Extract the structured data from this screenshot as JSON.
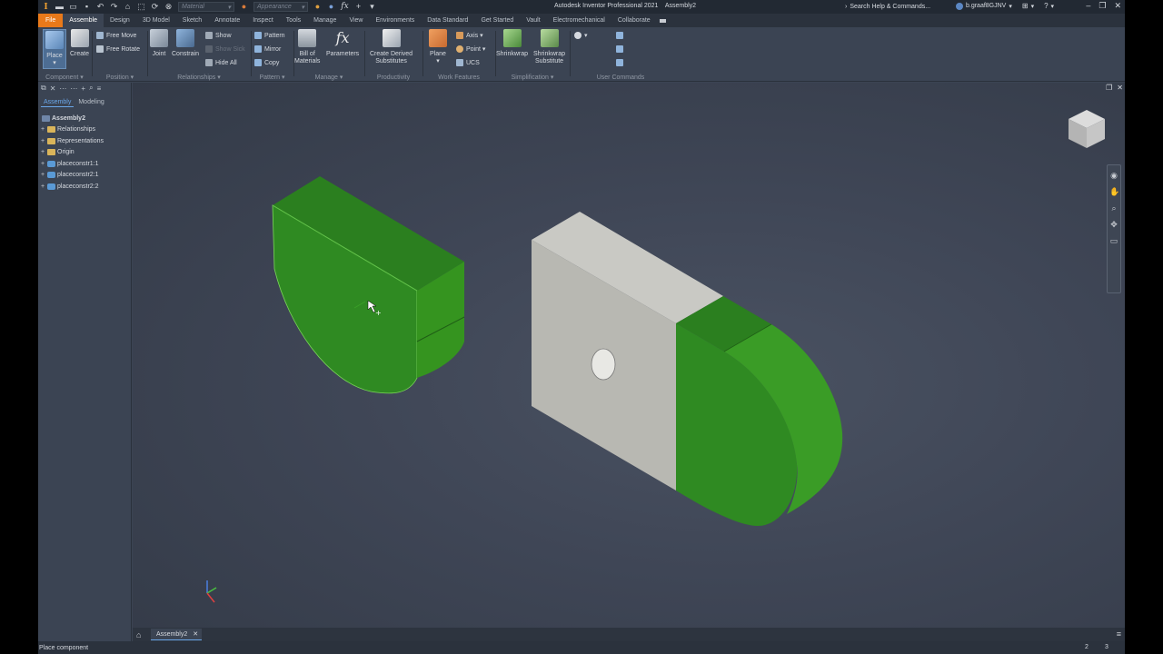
{
  "title_bar": {
    "app_title": "Autodesk Inventor Professional 2021",
    "doc_title": "Assembly2",
    "material_placeholder": "Material",
    "appearance_placeholder": "Appearance",
    "search_label": "Search Help & Commands...",
    "user_name": "b.graaf8GJNV"
  },
  "ribbon_tabs": [
    "File",
    "Assemble",
    "Design",
    "3D Model",
    "Sketch",
    "Annotate",
    "Inspect",
    "Tools",
    "Manage",
    "View",
    "Environments",
    "Data Standard",
    "Get Started",
    "Vault",
    "Electromechanical",
    "Collaborate"
  ],
  "ribbon": {
    "component": {
      "place": "Place",
      "create": "Create",
      "label": "Component ▾"
    },
    "position": {
      "free_move": "Free Move",
      "free_rotate": "Free Rotate",
      "label": "Position ▾"
    },
    "relationships": {
      "joint": "Joint",
      "constrain": "Constrain",
      "show": "Show",
      "show_sick": "Show Sick",
      "hide_all": "Hide All",
      "label": "Relationships ▾"
    },
    "pattern": {
      "pattern": "Pattern",
      "mirror": "Mirror",
      "copy": "Copy",
      "label": "Pattern ▾"
    },
    "manage": {
      "bom_line1": "Bill of",
      "bom_line2": "Materials",
      "parameters": "Parameters",
      "label": "Manage ▾"
    },
    "productivity": {
      "cds_line1": "Create Derived",
      "cds_line2": "Substitutes",
      "label": "Productivity"
    },
    "work_features": {
      "plane": "Plane",
      "axis": "Axis ▾",
      "point": "Point ▾",
      "ucs": "UCS",
      "label": "Work Features"
    },
    "simplification": {
      "shrinkwrap": "Shrinkwrap",
      "ss_line1": "Shrinkwrap",
      "ss_line2": "Substitute",
      "label": "Simplification ▾"
    },
    "user_commands": {
      "label": "User Commands"
    }
  },
  "browser": {
    "tabs": [
      "Assembly",
      "Modeling"
    ],
    "tree": [
      {
        "label": "Assembly2",
        "type": "assembly",
        "expander": ""
      },
      {
        "label": "Relationships",
        "type": "folder",
        "expander": "+"
      },
      {
        "label": "Representations",
        "type": "folder",
        "expander": "+"
      },
      {
        "label": "Origin",
        "type": "folder",
        "expander": "+"
      },
      {
        "label": "placeconstr1:1",
        "type": "part",
        "expander": "+"
      },
      {
        "label": "placeconstr2:1",
        "type": "part",
        "expander": "+"
      },
      {
        "label": "placeconstr2:2",
        "type": "part",
        "expander": "+"
      }
    ]
  },
  "document_tabs": [
    {
      "label": "Assembly2",
      "close": "✕"
    }
  ],
  "status_bar": {
    "message": "Place component",
    "count_a": "2",
    "count_b": "3"
  },
  "colors": {
    "file_tab": "#e8791a",
    "part_green": "#2f8a22",
    "part_grey": "#c9c9c4",
    "background": "#3b4453"
  }
}
